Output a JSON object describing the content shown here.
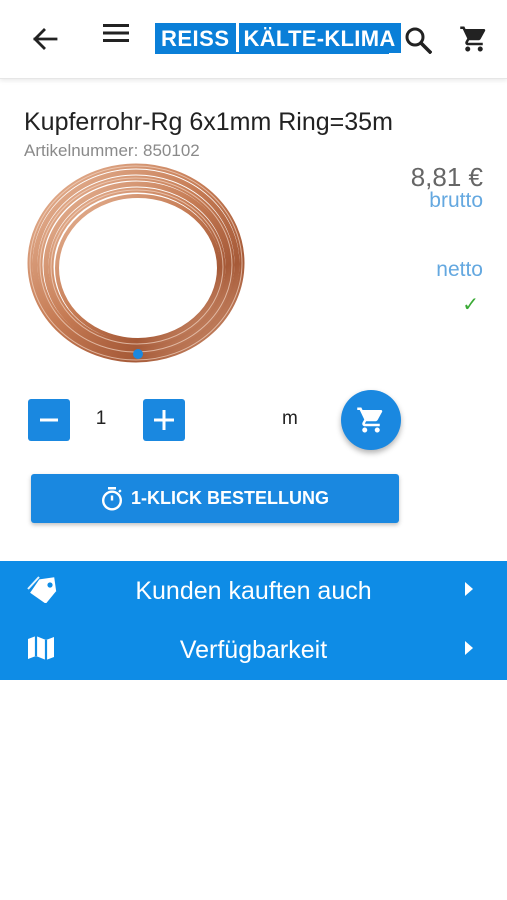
{
  "header": {
    "back_icon": "arrow-back-icon",
    "menu_icon": "menu-icon",
    "logo_part1": "REISS",
    "logo_part2": "KÄLTE-KLIMA",
    "search_icon": "search-icon",
    "cart_icon": "cart-icon"
  },
  "product": {
    "title": "Kupferrohr-Rg 6x1mm Ring=35m",
    "article_number": "Artikelnummer: 850102",
    "price": "8,81 €",
    "brutto_label": "brutto",
    "netto_label": "netto",
    "availability_mark": "✓",
    "image_pager_dots": 1
  },
  "order": {
    "quantity": "1",
    "unit": "m",
    "one_click_label": "1-KLICK BESTELLUNG"
  },
  "panel": {
    "items": [
      {
        "label": "Kunden kauften auch",
        "icon": "tag-icon"
      },
      {
        "label": "Verfügbarkeit",
        "icon": "map-icon"
      }
    ]
  },
  "colors": {
    "accent": "#1a88e0",
    "brand": "#0a7fd8",
    "price_label": "#64a8e0",
    "check": "#3aaa35"
  }
}
